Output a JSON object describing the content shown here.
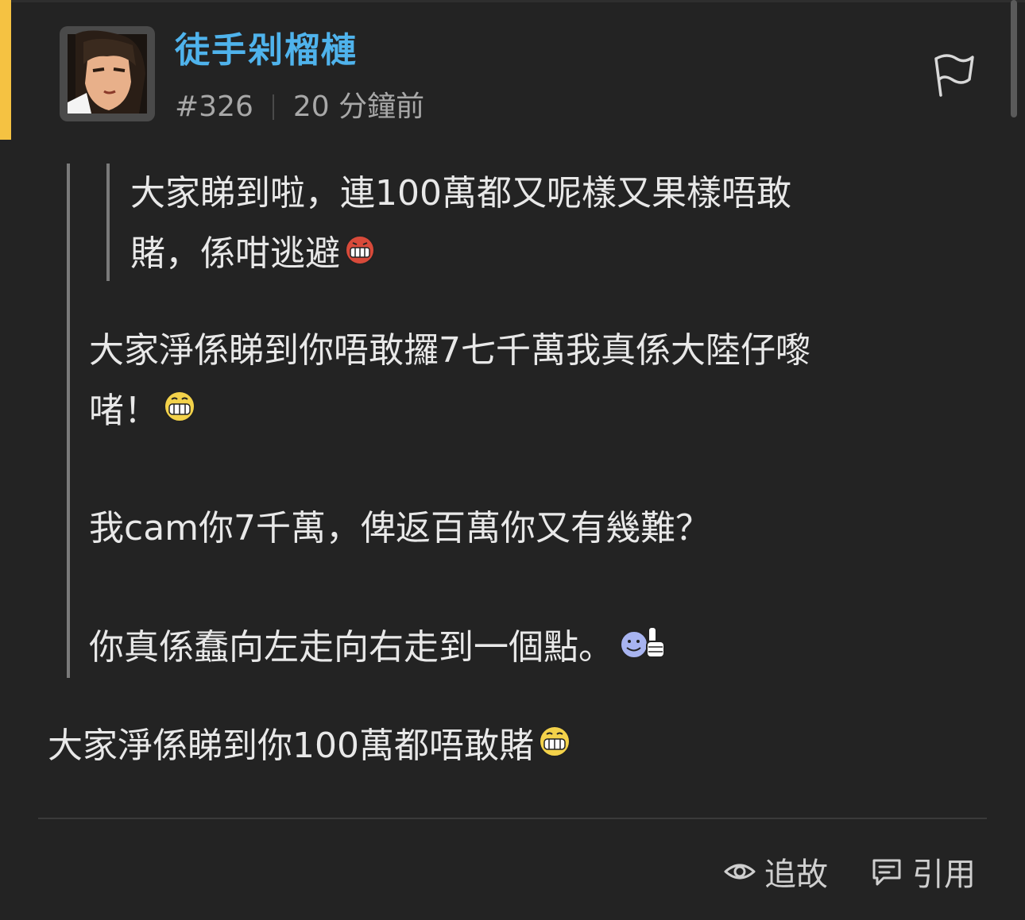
{
  "post": {
    "username": "徒手剁榴槤",
    "number": "#326",
    "time": "20 分鐘前"
  },
  "inner_quote": {
    "line1": "大家睇到啦，連100萬都又呢樣又果樣唔敢",
    "line2": "賭，係咁逃避"
  },
  "outer_quote": {
    "line1": "大家淨係睇到你唔敢攞7七千萬我真係大陸仔嚟",
    "line2": "啫！",
    "line3": "我cam你7千萬，俾返百萬你又有幾難？",
    "line4": "你真係蠢向左走向右走到一個點。"
  },
  "reply": {
    "text": "大家淨係睇到你100萬都唔敢賭"
  },
  "actions": {
    "follow_label": "追故",
    "quote_label": "引用"
  },
  "colors": {
    "accent": "#f5c242",
    "username": "#4fb3ec",
    "background": "#232323"
  },
  "icons": {
    "flag": "flag-icon",
    "eye": "eye-icon",
    "quote": "quote-icon"
  }
}
